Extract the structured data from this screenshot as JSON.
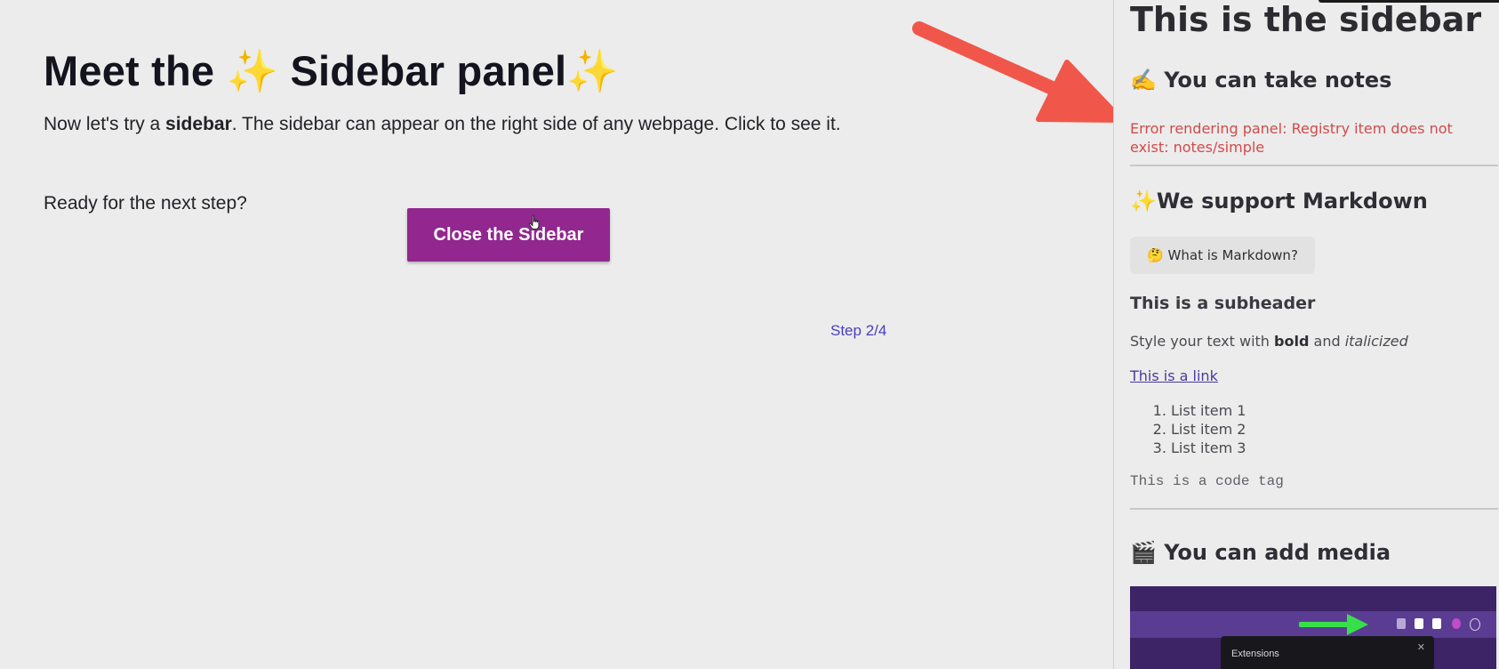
{
  "main": {
    "title_before": "Meet the ",
    "title_sparkle_1": "✨",
    "title_middle": " Sidebar panel",
    "title_sparkle_2": "✨",
    "intro_before": "Now let's try a ",
    "intro_bold": "sidebar",
    "intro_after": ". The sidebar can appear on the right side of any webpage. Click to see it.",
    "ready_text": "Ready for the next step?",
    "close_button_label": "Close the Sidebar",
    "step_label": "Step 2/4"
  },
  "sidebar": {
    "title": "This is the sidebar",
    "notes_emoji": "✍️",
    "notes_heading": "You can take notes",
    "error_text": "Error rendering panel: Registry item does not exist: notes/simple",
    "markdown_emoji": "✨",
    "markdown_heading": "We support Markdown",
    "markdown_button_emoji": "🤔",
    "markdown_button_label": "What is Markdown?",
    "subheader": "This is a subheader",
    "style_before": "Style your text with ",
    "style_bold": "bold",
    "style_and": " and ",
    "style_italic": "italicized",
    "link_text": "This is a link",
    "list_items": [
      "List item 1",
      "List item 2",
      "List item 3"
    ],
    "code_text": "This is a code tag",
    "media_emoji": "🎬",
    "media_heading": "You can add media",
    "media_popup_label": "Extensions",
    "media_popup_close": "✕"
  },
  "colors": {
    "background": "#ececec",
    "button_purple": "#92278f",
    "step_link": "#4a3ec0",
    "error_red": "#d24a4a",
    "annotation_arrow": "#f0574a",
    "media_arrow": "#37e04a"
  },
  "icons": {
    "annotation": "red-arrow-icon",
    "cursor": "hand-pointer-icon",
    "media_arrow": "green-arrow-icon"
  }
}
